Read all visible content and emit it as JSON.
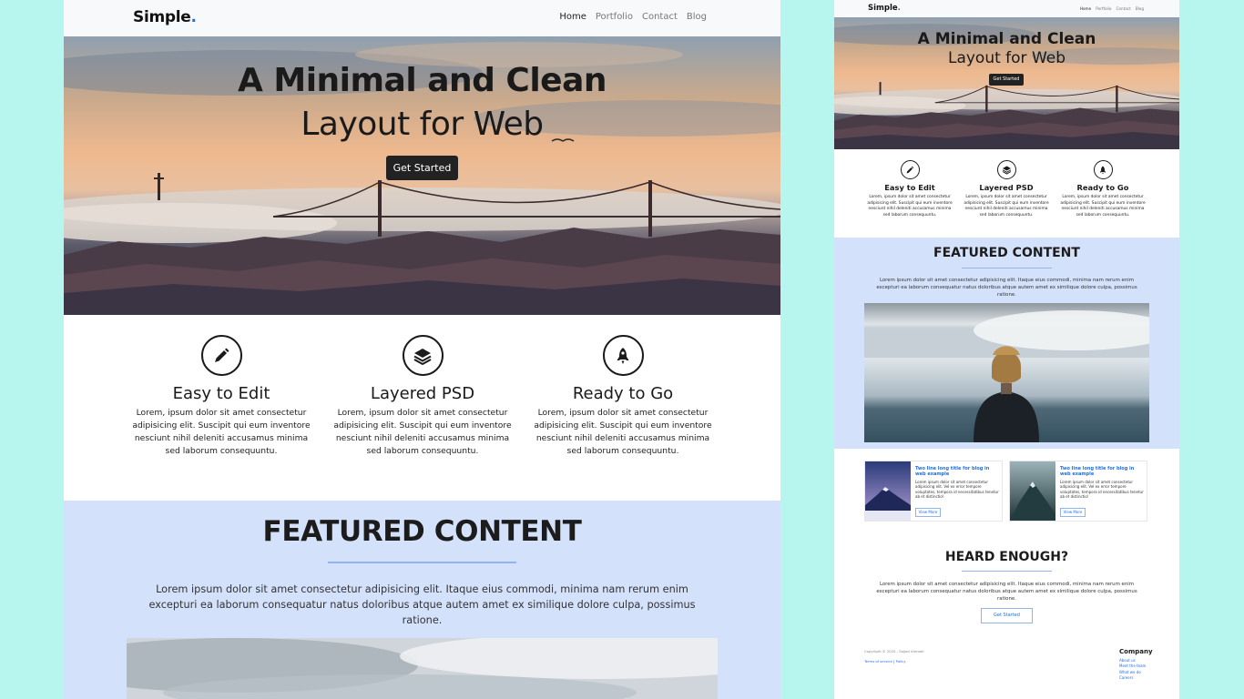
{
  "site": {
    "logo_text": "Simple",
    "logo_dot": ".",
    "accent_color": "#1f6fe5",
    "nav": [
      {
        "label": "Home",
        "active": true
      },
      {
        "label": "Portfolio",
        "active": false
      },
      {
        "label": "Contact",
        "active": false
      },
      {
        "label": "Blog",
        "active": false
      }
    ]
  },
  "hero": {
    "title_line1": "A Minimal and Clean",
    "title_line2": "Layout for Web",
    "button_label": "Get Started"
  },
  "features": [
    {
      "icon": "pencil-icon",
      "title": "Easy to Edit",
      "text": "Lorem, ipsum dolor sit amet consectetur adipisicing elit. Suscipit qui eum inventore nesciunt nihil deleniti accusamus minima sed laborum consequuntu."
    },
    {
      "icon": "layers-icon",
      "title": "Layered PSD",
      "text": "Lorem, ipsum dolor sit amet consectetur adipisicing elit. Suscipit qui eum inventore nesciunt nihil deleniti accusamus minima sed laborum consequuntu."
    },
    {
      "icon": "rocket-icon",
      "title": "Ready to Go",
      "text": "Lorem, ipsum dolor sit amet consectetur adipisicing elit. Suscipit qui eum inventore nesciunt nihil deleniti accusamus minima sed laborum consequuntu."
    }
  ],
  "featured": {
    "heading": "FEATURED CONTENT",
    "text": "Lorem ipsum dolor sit amet consectetur adipisicing elit. Itaque eius commodi, minima nam rerum enim excepturi ea laborum consequatur natus doloribus atque autem amet ex similique dolore culpa, possimus ratione."
  },
  "blog_cards": [
    {
      "title": "Two line long title for blog in web example",
      "text": "Lorem ipsum dolor sit amet consectetur adipisicing elit. Vel ex error tempore voluptates, tempora id necessitatibus tenetur ab et distinctio!",
      "button": "View More"
    },
    {
      "title": "Two line long title for blog in web example",
      "text": "Lorem ipsum dolor sit amet consectetur adipisicing elit. Vel ex error tempore voluptates, tempora id necessitatibus tenetur ab et distinctio!",
      "button": "View More"
    }
  ],
  "heard": {
    "heading": "HEARD ENOUGH?",
    "text": "Lorem ipsum dolor sit amet consectetur adipisicing elit. Itaque eius commodi, minima nam rerum enim excepturi ea laborum consequatur natus doloribus atque autem amet ex similique dolore culpa, possimus ratione.",
    "button": "Get Started"
  },
  "footer": {
    "copyright": "Copyright © 2020 - Sajjad Ahmadi",
    "terms": "Terms of service",
    "separator": "|",
    "policy": "Policy",
    "company_heading": "Company",
    "company_links": [
      "About us",
      "Meet the team",
      "What we do",
      "Careers"
    ]
  }
}
